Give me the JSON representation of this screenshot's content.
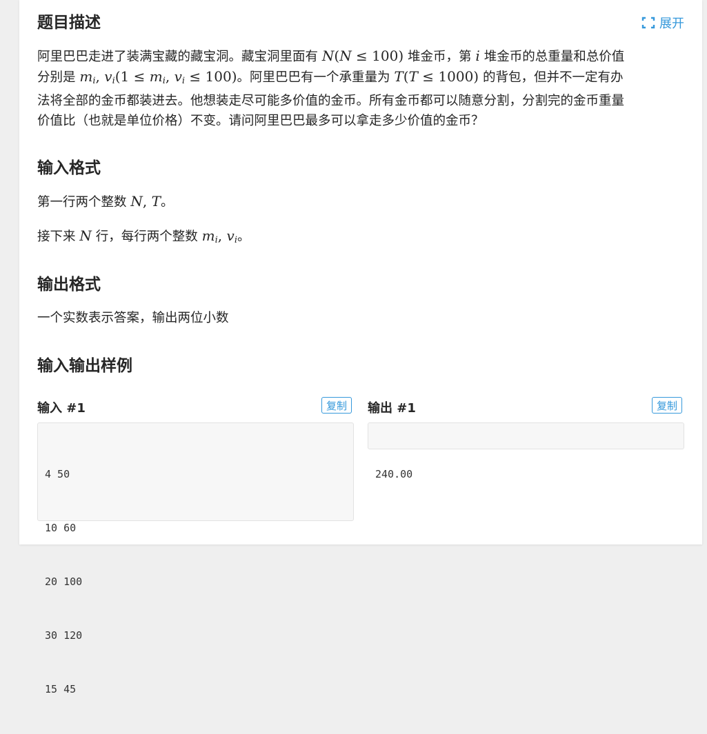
{
  "problem": {
    "expand_label": "展开",
    "description": {
      "title": "题目描述",
      "line1_a": "阿里巴巴走进了装满宝藏的藏宝洞。藏宝洞里面有 ",
      "line1_b": " 堆金币，第 ",
      "line1_c": " 堆金币的总重量和总价值",
      "line2_a": "分别是 ",
      "line2_b": "。阿里巴巴有一个承重量为 ",
      "line2_c": " 的背包，但并不一定有办",
      "line3": "法将全部的金币都装进去。他想装走尽可能多价值的金币。所有金币都可以随意分割，分割完的金币重量",
      "line4": "价值比（也就是单位价格）不变。请问阿里巴巴最多可以拿走多少价值的金币？"
    },
    "input_format": {
      "title": "输入格式",
      "line1_a": "第一行两个整数 ",
      "line1_b": "。",
      "line2_a": "接下来 ",
      "line2_b": " 行，每行两个整数 ",
      "line2_c": "。"
    },
    "output_format": {
      "title": "输出格式",
      "text": "一个实数表示答案，输出两位小数"
    },
    "samples": {
      "title": "输入输出样例",
      "input_label": "输入 #1",
      "output_label": "输出 #1",
      "copy_label": "复制",
      "input_lines": [
        "4 50",
        "10 60",
        "20 100",
        "30 120",
        "15 45"
      ],
      "output_lines": [
        "240.00"
      ]
    }
  },
  "colors": {
    "accent": "#3498db",
    "text": "#262626",
    "code_bg": "#f7f7f7",
    "page_bg": "#efefef"
  }
}
